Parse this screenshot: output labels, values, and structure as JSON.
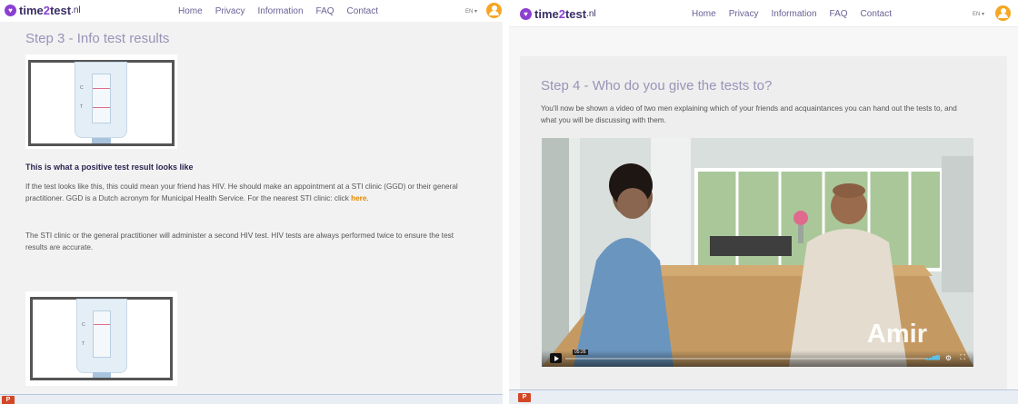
{
  "header": {
    "logo_part1": "time",
    "logo_part2": "2",
    "logo_part3": "test",
    "logo_tld": ".nl",
    "logo_mark": "♥",
    "nav": [
      "Home",
      "Privacy",
      "Information",
      "FAQ",
      "Contact"
    ],
    "language": "EN ▾",
    "user_icon": "user-icon"
  },
  "left": {
    "step_title": "Step 3 - Info test results",
    "test_marks": {
      "c": "C",
      "t": "T"
    },
    "positive_heading": "This is what a positive test result looks like",
    "para1": "If the test looks like this, this could mean your friend has HIV. He should make an appointment at a STI clinic (GGD) or their general practitioner. GGD is a Dutch acronym for Municipal Health Service. For the nearest STI clinic: click",
    "para1_link": "here",
    "para1_end": ".",
    "para2": "The STI clinic or the general practitioner will administer a second HIV test. HIV tests are always performed twice to ensure the test results are accurate."
  },
  "right": {
    "step_title": "Step 4 - Who do you give the tests to?",
    "intro": "You'll now be shown a video of two men explaining which of your friends and acquaintances you can hand out the tests to, and what you will be discussing with them.",
    "video": {
      "name_overlay": "Amir",
      "timecode": "05:26",
      "speaker_icon": "speaker-icon",
      "settings_icon": "gear-icon",
      "fullscreen_icon": "fullscreen-icon"
    }
  },
  "taskbar": {
    "app_icon": "powerpoint-icon",
    "app_letter": "P"
  },
  "colors": {
    "brand": "#8c3fd1",
    "nav_text": "#6b5f96",
    "title": "#9a93b8",
    "link": "#e08a00",
    "avatar": "#f5a623"
  }
}
